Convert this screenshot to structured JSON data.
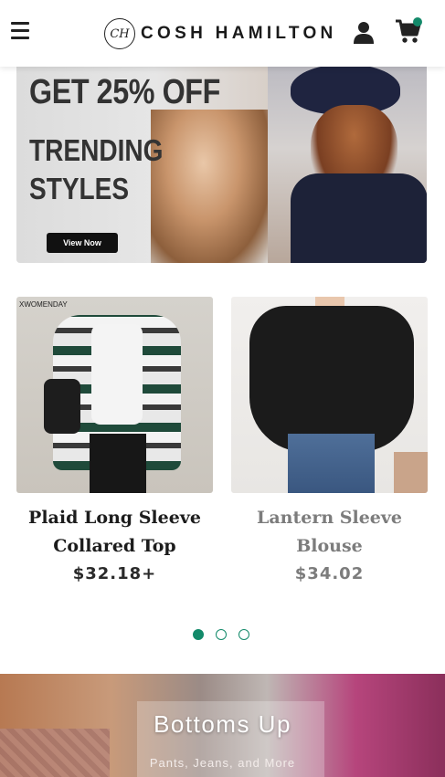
{
  "header": {
    "brand_monogram": "CH",
    "brand_name": "COSH HAMILTON",
    "cart_indicator_color": "#138a6a",
    "icons": [
      "menu-icon",
      "user-icon",
      "cart-icon"
    ]
  },
  "hero": {
    "headline": "GET 25% OFF",
    "subheadline": "TRENDING\nSTYLES",
    "cta_label": "View Now"
  },
  "products": [
    {
      "watermark": "XWOMENDAY",
      "title": "Plaid Long Sleeve Collared Top",
      "price": "$32.18+"
    },
    {
      "title": "Lantern Sleeve Blouse",
      "price": "$34.02"
    }
  ],
  "carousel": {
    "page_count": 3,
    "active_index": 0,
    "accent_color": "#138a6a"
  },
  "collection_banner": {
    "title": "Bottoms Up",
    "subtitle": "Pants, Jeans, and More"
  }
}
